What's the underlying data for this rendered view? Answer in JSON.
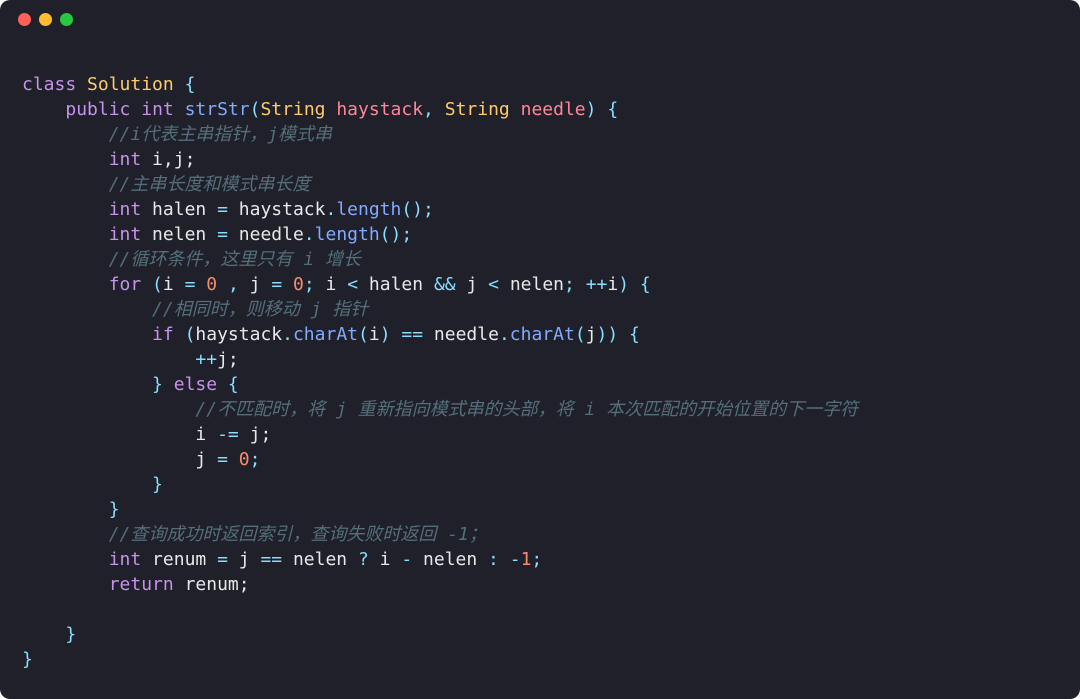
{
  "titlebar": {
    "red": "close",
    "yellow": "minimize",
    "green": "maximize"
  },
  "code": {
    "line1": {
      "kw_class": "class",
      "cls": "Solution",
      "brace": " {"
    },
    "line2": {
      "indent": "    ",
      "kw_public": "public",
      "type_int": "int",
      "fn": "strStr",
      "open": "(",
      "type_str1": "String",
      "p1": "haystack",
      "comma": ",",
      "type_str2": "String",
      "p2": "needle",
      "close": ")",
      "brace": " {"
    },
    "line3": {
      "indent": "        ",
      "comment": "//i代表主串指针，j模式串"
    },
    "line4": {
      "indent": "        ",
      "type_int": "int",
      "vars": " i,j;"
    },
    "line5": {
      "indent": "        ",
      "comment": "//主串长度和模式串长度"
    },
    "line6": {
      "indent": "        ",
      "type_int": "int",
      "v": " halen ",
      "eq": "=",
      "sp": " ",
      "obj": "haystack",
      "dot": ".",
      "call": "length",
      "paren": "();"
    },
    "line7": {
      "indent": "        ",
      "type_int": "int",
      "v": " nelen ",
      "eq": "=",
      "sp": " ",
      "obj": "needle",
      "dot": ".",
      "call": "length",
      "paren": "();"
    },
    "line8": {
      "indent": "        ",
      "comment": "//循环条件，这里只有 i 增长"
    },
    "line9": {
      "indent": "        ",
      "kw_for": "for",
      "open": " (",
      "v1": "i ",
      "eq1": "=",
      "sp1": " ",
      "n0a": "0",
      "comma1": " , ",
      "v2": "j ",
      "eq2": "=",
      "sp2": " ",
      "n0b": "0",
      "semi1": "; ",
      "v3": "i ",
      "lt": "<",
      "v4": " halen ",
      "and": "&&",
      "v5": " j ",
      "lt2": "<",
      "v6": " nelen",
      "semi2": "; ",
      "inc": "++",
      "v7": "i",
      "close": ") {"
    },
    "line10": {
      "indent": "            ",
      "comment": "//相同时，则移动 j 指针"
    },
    "line11": {
      "indent": "            ",
      "kw_if": "if",
      "open": " (",
      "obj1": "haystack",
      "dot1": ".",
      "m1": "charAt",
      "p1o": "(",
      "a1": "i",
      "p1c": ") ",
      "eqeq": "==",
      "sp": " ",
      "obj2": "needle",
      "dot2": ".",
      "m2": "charAt",
      "p2o": "(",
      "a2": "j",
      "p2c": ")) {"
    },
    "line12": {
      "indent": "                ",
      "inc": "++",
      "v": "j;"
    },
    "line13": {
      "indent": "            ",
      "close": "}",
      "kw_else": " else ",
      "brace": "{"
    },
    "line14": {
      "indent": "                ",
      "comment": "//不匹配时，将 j 重新指向模式串的头部，将 i 本次匹配的开始位置的下一字符"
    },
    "line15": {
      "indent": "                ",
      "v1": "i ",
      "op": "-=",
      "v2": " j;"
    },
    "line16": {
      "indent": "                ",
      "v": "j ",
      "eq": "=",
      "sp": " ",
      "n0": "0",
      "semi": ";"
    },
    "line17": {
      "indent": "            ",
      "close": "}"
    },
    "line18": {
      "indent": "        ",
      "close": "}"
    },
    "line19": {
      "indent": "        ",
      "comment": "//查询成功时返回索引，查询失败时返回 -1；"
    },
    "line20": {
      "indent": "        ",
      "type_int": "int",
      "v": " renum ",
      "eq": "=",
      "expr": " j ",
      "eqeq": "==",
      "v2": " nelen ",
      "q": "?",
      "v3": " i ",
      "minus": "-",
      "v4": " nelen ",
      "colon": ":",
      "sp": " ",
      "neg": "-",
      "one": "1",
      "semi": ";"
    },
    "line21": {
      "indent": "        ",
      "kw_return": "return",
      "v": " renum;"
    },
    "line22": {
      "indent": "",
      "blank": ""
    },
    "line23": {
      "indent": "    ",
      "close": "}"
    },
    "line24": {
      "indent": "",
      "close": "}"
    }
  }
}
